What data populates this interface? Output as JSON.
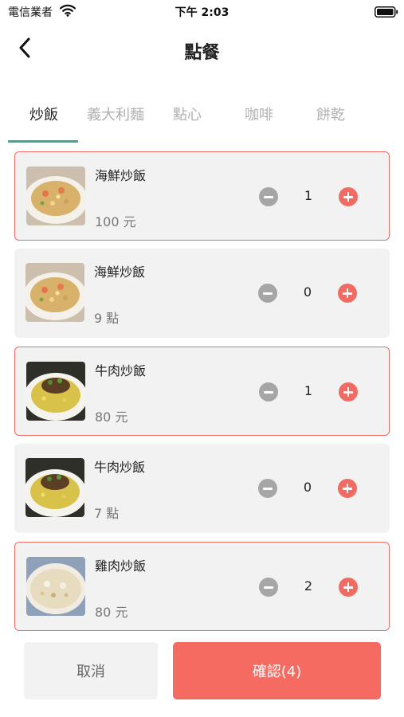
{
  "status_bar": {
    "carrier": "電信業者",
    "time": "下午 2:03"
  },
  "nav": {
    "title": "點餐"
  },
  "tabs": [
    {
      "label": "炒飯",
      "active": true
    },
    {
      "label": "義大利麵",
      "active": false
    },
    {
      "label": "點心",
      "active": false
    },
    {
      "label": "咖啡",
      "active": false
    },
    {
      "label": "餅乾",
      "active": false
    }
  ],
  "items": [
    {
      "name": "海鮮炒飯",
      "price": "100 元",
      "qty": "1",
      "selected": true,
      "thumb": "seafood-fried-rice-photo"
    },
    {
      "name": "海鮮炒飯",
      "price": "9 點",
      "qty": "0",
      "selected": false,
      "thumb": "seafood-fried-rice-photo"
    },
    {
      "name": "牛肉炒飯",
      "price": "80 元",
      "qty": "1",
      "selected": true,
      "thumb": "beef-fried-rice-photo"
    },
    {
      "name": "牛肉炒飯",
      "price": "7 點",
      "qty": "0",
      "selected": false,
      "thumb": "beef-fried-rice-photo"
    },
    {
      "name": "雞肉炒飯",
      "price": "80 元",
      "qty": "2",
      "selected": true,
      "thumb": "chicken-fried-rice-photo"
    }
  ],
  "footer": {
    "cancel_label": "取消",
    "confirm_label": "確認(4)"
  },
  "colors": {
    "accent": "#f06b63",
    "tab_indicator": "#5b9a8b",
    "card_bg": "#f2f2f2"
  }
}
